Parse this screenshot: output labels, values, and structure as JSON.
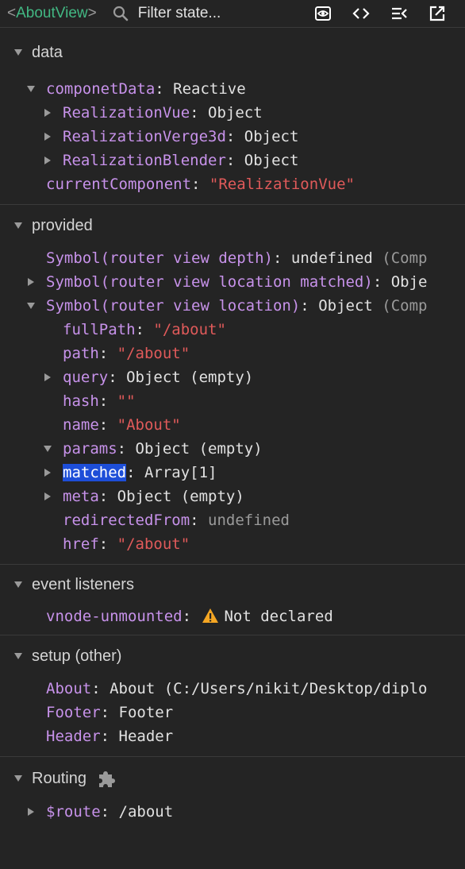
{
  "header": {
    "open_bracket": "<",
    "component": "AboutView",
    "close_bracket": ">",
    "filter_placeholder": "Filter state..."
  },
  "sections": {
    "data": {
      "title": "data",
      "componetData": {
        "key": "componetData",
        "value": "Reactive"
      },
      "realization_vue": {
        "key": "RealizationVue",
        "value": "Object"
      },
      "realization_verge3d": {
        "key": "RealizationVerge3d",
        "value": "Object"
      },
      "realization_blender": {
        "key": "RealizationBlender",
        "value": "Object"
      },
      "current_component": {
        "key": "currentComponent",
        "value": "\"RealizationVue\""
      }
    },
    "provided": {
      "title": "provided",
      "depth": {
        "key": "Symbol(router view depth)",
        "value": "undefined",
        "note": "(Comp"
      },
      "location_matched": {
        "key": "Symbol(router view location matched)",
        "value": "Obje"
      },
      "location": {
        "key": "Symbol(router view location)",
        "value": "Object",
        "note": "(Comp"
      },
      "fullPath": {
        "key": "fullPath",
        "value": "\"/about\""
      },
      "path": {
        "key": "path",
        "value": "\"/about\""
      },
      "query": {
        "key": "query",
        "value": "Object (empty)"
      },
      "hash": {
        "key": "hash",
        "value": "\"\""
      },
      "name": {
        "key": "name",
        "value": "\"About\""
      },
      "params": {
        "key": "params",
        "value": "Object (empty)"
      },
      "matched": {
        "key": "matched",
        "value": "Array[1]"
      },
      "meta": {
        "key": "meta",
        "value": "Object (empty)"
      },
      "redirectedFrom": {
        "key": "redirectedFrom",
        "value": "undefined"
      },
      "href": {
        "key": "href",
        "value": "\"/about\""
      }
    },
    "event_listeners": {
      "title": "event listeners",
      "vnode_unmounted": {
        "key": "vnode-unmounted",
        "value": "Not declared"
      }
    },
    "setup_other": {
      "title": "setup (other)",
      "about": {
        "key": "About",
        "value": "About (C:/Users/nikit/Desktop/diplo"
      },
      "footer": {
        "key": "Footer",
        "value": "Footer"
      },
      "header": {
        "key": "Header",
        "value": "Header"
      }
    },
    "routing": {
      "title": "Routing",
      "route": {
        "key": "$route",
        "value": "/about"
      }
    }
  },
  "colors": {
    "background": "#242424",
    "accent_component": "#42b883",
    "key": "#c792ea",
    "string": "#e05a5a",
    "muted": "#9a9a9a",
    "highlight": "#1d4ed8",
    "warning": "#f5a623"
  },
  "icons": [
    "search-icon",
    "eye-icon",
    "code-icon",
    "list-collapse-icon",
    "open-external-icon",
    "warning-icon",
    "puzzle-icon"
  ]
}
